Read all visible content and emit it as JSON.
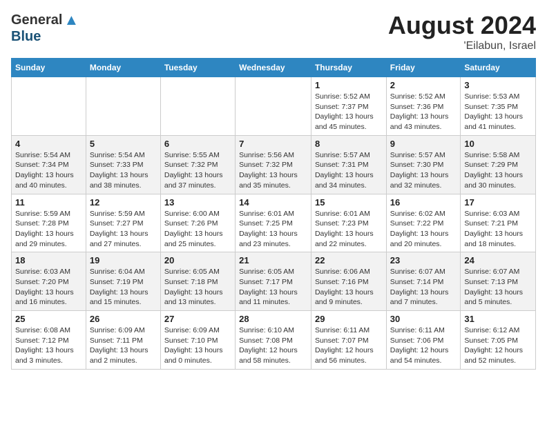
{
  "header": {
    "logo_general": "General",
    "logo_blue": "Blue",
    "month": "August 2024",
    "location": "'Eilabun, Israel"
  },
  "days_of_week": [
    "Sunday",
    "Monday",
    "Tuesday",
    "Wednesday",
    "Thursday",
    "Friday",
    "Saturday"
  ],
  "weeks": [
    [
      {
        "day": "",
        "info": ""
      },
      {
        "day": "",
        "info": ""
      },
      {
        "day": "",
        "info": ""
      },
      {
        "day": "",
        "info": ""
      },
      {
        "day": "1",
        "info": "Sunrise: 5:52 AM\nSunset: 7:37 PM\nDaylight: 13 hours\nand 45 minutes."
      },
      {
        "day": "2",
        "info": "Sunrise: 5:52 AM\nSunset: 7:36 PM\nDaylight: 13 hours\nand 43 minutes."
      },
      {
        "day": "3",
        "info": "Sunrise: 5:53 AM\nSunset: 7:35 PM\nDaylight: 13 hours\nand 41 minutes."
      }
    ],
    [
      {
        "day": "4",
        "info": "Sunrise: 5:54 AM\nSunset: 7:34 PM\nDaylight: 13 hours\nand 40 minutes."
      },
      {
        "day": "5",
        "info": "Sunrise: 5:54 AM\nSunset: 7:33 PM\nDaylight: 13 hours\nand 38 minutes."
      },
      {
        "day": "6",
        "info": "Sunrise: 5:55 AM\nSunset: 7:32 PM\nDaylight: 13 hours\nand 37 minutes."
      },
      {
        "day": "7",
        "info": "Sunrise: 5:56 AM\nSunset: 7:32 PM\nDaylight: 13 hours\nand 35 minutes."
      },
      {
        "day": "8",
        "info": "Sunrise: 5:57 AM\nSunset: 7:31 PM\nDaylight: 13 hours\nand 34 minutes."
      },
      {
        "day": "9",
        "info": "Sunrise: 5:57 AM\nSunset: 7:30 PM\nDaylight: 13 hours\nand 32 minutes."
      },
      {
        "day": "10",
        "info": "Sunrise: 5:58 AM\nSunset: 7:29 PM\nDaylight: 13 hours\nand 30 minutes."
      }
    ],
    [
      {
        "day": "11",
        "info": "Sunrise: 5:59 AM\nSunset: 7:28 PM\nDaylight: 13 hours\nand 29 minutes."
      },
      {
        "day": "12",
        "info": "Sunrise: 5:59 AM\nSunset: 7:27 PM\nDaylight: 13 hours\nand 27 minutes."
      },
      {
        "day": "13",
        "info": "Sunrise: 6:00 AM\nSunset: 7:26 PM\nDaylight: 13 hours\nand 25 minutes."
      },
      {
        "day": "14",
        "info": "Sunrise: 6:01 AM\nSunset: 7:25 PM\nDaylight: 13 hours\nand 23 minutes."
      },
      {
        "day": "15",
        "info": "Sunrise: 6:01 AM\nSunset: 7:23 PM\nDaylight: 13 hours\nand 22 minutes."
      },
      {
        "day": "16",
        "info": "Sunrise: 6:02 AM\nSunset: 7:22 PM\nDaylight: 13 hours\nand 20 minutes."
      },
      {
        "day": "17",
        "info": "Sunrise: 6:03 AM\nSunset: 7:21 PM\nDaylight: 13 hours\nand 18 minutes."
      }
    ],
    [
      {
        "day": "18",
        "info": "Sunrise: 6:03 AM\nSunset: 7:20 PM\nDaylight: 13 hours\nand 16 minutes."
      },
      {
        "day": "19",
        "info": "Sunrise: 6:04 AM\nSunset: 7:19 PM\nDaylight: 13 hours\nand 15 minutes."
      },
      {
        "day": "20",
        "info": "Sunrise: 6:05 AM\nSunset: 7:18 PM\nDaylight: 13 hours\nand 13 minutes."
      },
      {
        "day": "21",
        "info": "Sunrise: 6:05 AM\nSunset: 7:17 PM\nDaylight: 13 hours\nand 11 minutes."
      },
      {
        "day": "22",
        "info": "Sunrise: 6:06 AM\nSunset: 7:16 PM\nDaylight: 13 hours\nand 9 minutes."
      },
      {
        "day": "23",
        "info": "Sunrise: 6:07 AM\nSunset: 7:14 PM\nDaylight: 13 hours\nand 7 minutes."
      },
      {
        "day": "24",
        "info": "Sunrise: 6:07 AM\nSunset: 7:13 PM\nDaylight: 13 hours\nand 5 minutes."
      }
    ],
    [
      {
        "day": "25",
        "info": "Sunrise: 6:08 AM\nSunset: 7:12 PM\nDaylight: 13 hours\nand 3 minutes."
      },
      {
        "day": "26",
        "info": "Sunrise: 6:09 AM\nSunset: 7:11 PM\nDaylight: 13 hours\nand 2 minutes."
      },
      {
        "day": "27",
        "info": "Sunrise: 6:09 AM\nSunset: 7:10 PM\nDaylight: 13 hours\nand 0 minutes."
      },
      {
        "day": "28",
        "info": "Sunrise: 6:10 AM\nSunset: 7:08 PM\nDaylight: 12 hours\nand 58 minutes."
      },
      {
        "day": "29",
        "info": "Sunrise: 6:11 AM\nSunset: 7:07 PM\nDaylight: 12 hours\nand 56 minutes."
      },
      {
        "day": "30",
        "info": "Sunrise: 6:11 AM\nSunset: 7:06 PM\nDaylight: 12 hours\nand 54 minutes."
      },
      {
        "day": "31",
        "info": "Sunrise: 6:12 AM\nSunset: 7:05 PM\nDaylight: 12 hours\nand 52 minutes."
      }
    ]
  ]
}
